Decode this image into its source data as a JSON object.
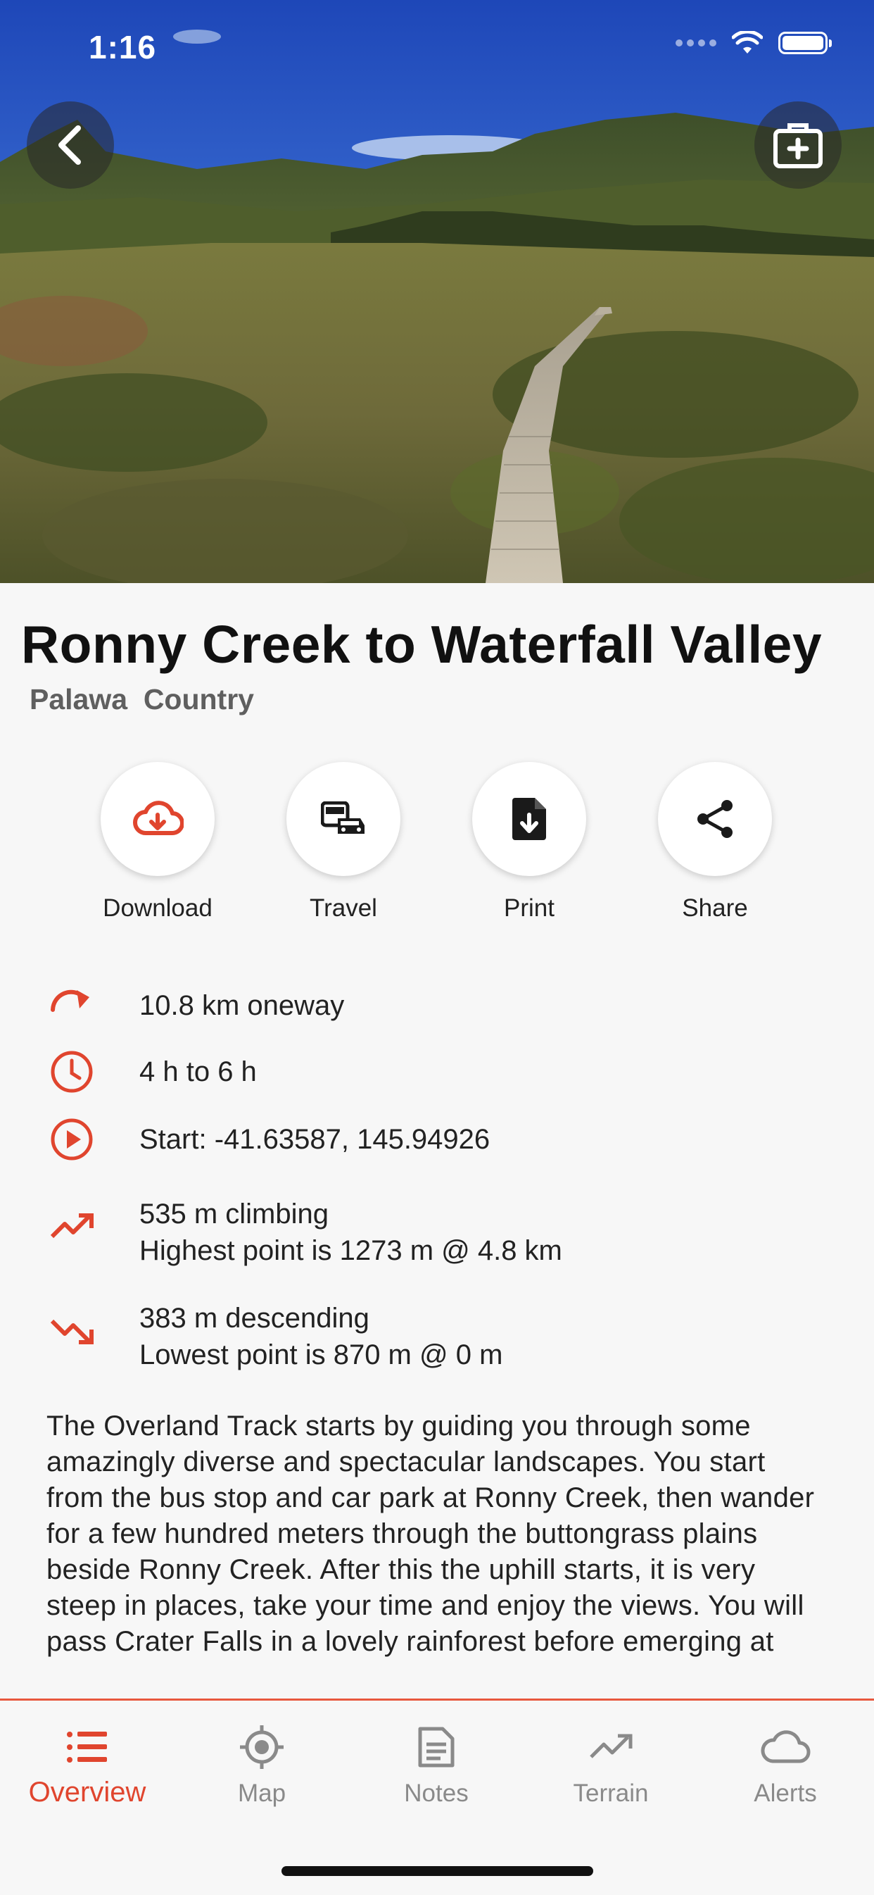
{
  "status": {
    "time": "1:16"
  },
  "hero": {
    "back_icon": "chevron-left-icon",
    "kit_icon": "first-aid-kit-icon"
  },
  "track": {
    "title": "Ronny Creek to Waterfall Valley",
    "subtitle": "Palawa  Country"
  },
  "actions": [
    {
      "label": "Download",
      "icon": "cloud-download-icon"
    },
    {
      "label": "Travel",
      "icon": "bus-car-icon"
    },
    {
      "label": "Print",
      "icon": "file-download-icon"
    },
    {
      "label": "Share",
      "icon": "share-icon"
    }
  ],
  "stats": {
    "distance": "10.8 km oneway",
    "duration": "4 h to 6 h",
    "start": "Start: -41.63587, 145.94926",
    "climbing": "535 m climbing",
    "highest": "Highest point is 1273 m @ 4.8 km",
    "descending": "383 m descending",
    "lowest": "Lowest point is 870 m @ 0 m"
  },
  "description": "The Overland Track starts by guiding you through some amazingly diverse and spectacular landscapes. You start from the bus stop and car park at Ronny Creek,  then wander for a few hundred meters through the buttongrass plains beside Ronny Creek. After this the uphill starts, it is very steep in places, take your time and enjoy the views. You will pass Crater Falls in a lovely rainforest before emerging at",
  "tabs": [
    {
      "label": "Overview",
      "icon": "list-icon",
      "active": true
    },
    {
      "label": "Map",
      "icon": "location-target-icon",
      "active": false
    },
    {
      "label": "Notes",
      "icon": "notes-icon",
      "active": false
    },
    {
      "label": "Terrain",
      "icon": "trending-up-icon",
      "active": false
    },
    {
      "label": "Alerts",
      "icon": "cloud-icon",
      "active": false
    }
  ],
  "colors": {
    "accent": "#e0452e",
    "text": "#1a1a1a",
    "muted": "#8a8a8a"
  }
}
